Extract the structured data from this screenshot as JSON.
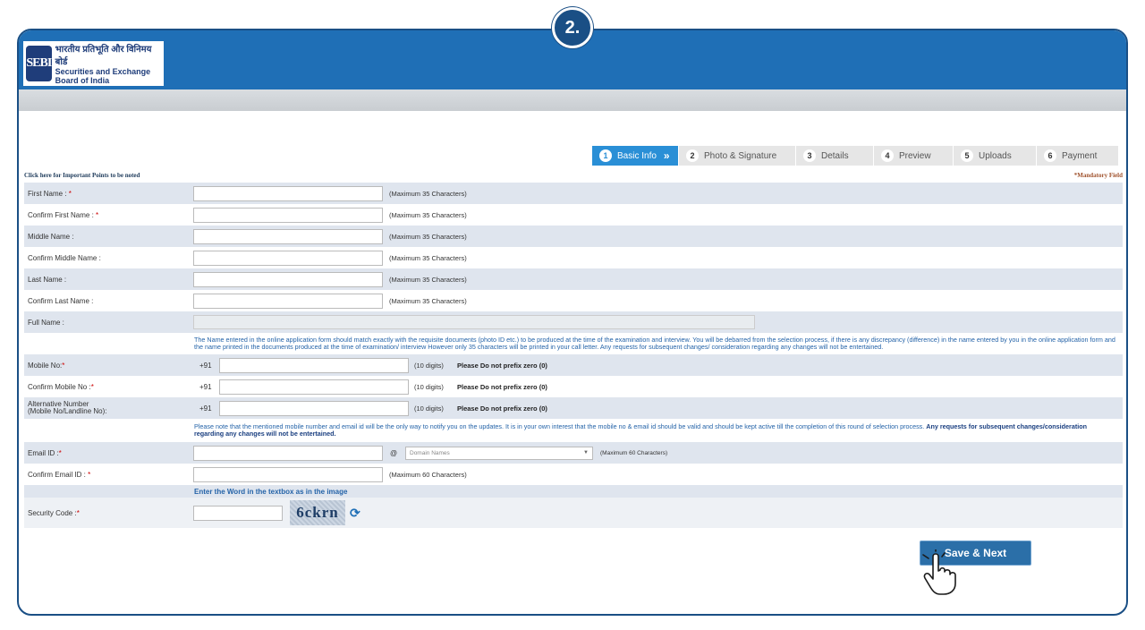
{
  "step_badge": "2.",
  "logo": {
    "mark": "SEBI",
    "hindi": "भारतीय प्रतिभूति और विनिमय बोर्ड",
    "english": "Securities and Exchange Board of India"
  },
  "stepper": [
    {
      "num": "1",
      "label": "Basic Info",
      "active": true
    },
    {
      "num": "2",
      "label": "Photo & Signature",
      "active": false
    },
    {
      "num": "3",
      "label": "Details",
      "active": false
    },
    {
      "num": "4",
      "label": "Preview",
      "active": false
    },
    {
      "num": "5",
      "label": "Uploads",
      "active": false
    },
    {
      "num": "6",
      "label": "Payment",
      "active": false
    }
  ],
  "notes": {
    "left": "Click here for Important Points to be noted",
    "right": "*Mandatory Field"
  },
  "fields": {
    "first_name": {
      "label": "First Name :",
      "req": "*",
      "hint": "(Maximum 35 Characters)"
    },
    "confirm_first_name": {
      "label": "Confirm First Name :",
      "req": "*",
      "hint": "(Maximum 35 Characters)"
    },
    "middle_name": {
      "label": "Middle Name :",
      "hint": "(Maximum 35 Characters)"
    },
    "confirm_middle_name": {
      "label": "Confirm Middle Name :",
      "hint": "(Maximum 35 Characters)"
    },
    "last_name": {
      "label": "Last Name :",
      "hint": "(Maximum 35 Characters)"
    },
    "confirm_last_name": {
      "label": "Confirm Last Name :",
      "hint": "(Maximum 35 Characters)"
    },
    "full_name": {
      "label": "Full Name :"
    },
    "name_info": "The Name entered in the online application form should match exactly with the requisite documents (photo ID etc.) to be produced at the time of the examination and interview. You will be debarred from the selection process, if there is any discrepancy (difference) in the name entered by you in the online application form and the name printed in the documents produced at the time of examination/ interview However only 35 characters will be printed in your call letter. Any requests for subsequent changes/ consideration regarding any changes will not be entertained.",
    "mobile": {
      "label": "Mobile No:",
      "req": "*",
      "prefix": "+91",
      "digits": "(10 digits)",
      "warn": "Please Do not prefix zero (0)"
    },
    "confirm_mobile": {
      "label": "Confirm Mobile No :",
      "req": "*",
      "prefix": "+91",
      "digits": "(10 digits)",
      "warn": "Please Do not prefix zero (0)"
    },
    "alt_mobile": {
      "label_line1": "Alternative Number",
      "label_line2": "(Mobile No/Landline No):",
      "prefix": "+91",
      "digits": "(10 digits)",
      "warn": "Please Do not prefix zero (0)"
    },
    "mobile_info": "Please note that the mentioned mobile number and email id will be the only way to notify you on the updates. It is in your own interest that the mobile no & email id should be valid and should be kept active till the completion of this round of selection process.",
    "mobile_info_bold": "Any requests for subsequent changes/consideration regarding any changes will not be entertained.",
    "email": {
      "label": "Email ID :",
      "req": "*",
      "at": "@",
      "domain_placeholder": "Domain Names",
      "hint": "(Maximum 60 Characters)"
    },
    "confirm_email": {
      "label": "Confirm Email ID :",
      "req": "*",
      "hint": "(Maximum 60 Characters)"
    },
    "captcha_instruction": "Enter the Word in the textbox as in the image",
    "security_code": {
      "label": "Security Code :",
      "req": "*",
      "captcha_text": "6ckrn"
    }
  },
  "save_button": "Save & Next",
  "colors": {
    "frame": "#1a4f85",
    "header": "#1f6fb6",
    "row_alt": "#dfe5ee",
    "info_text": "#2463a8",
    "button": "#2b6fa8"
  }
}
